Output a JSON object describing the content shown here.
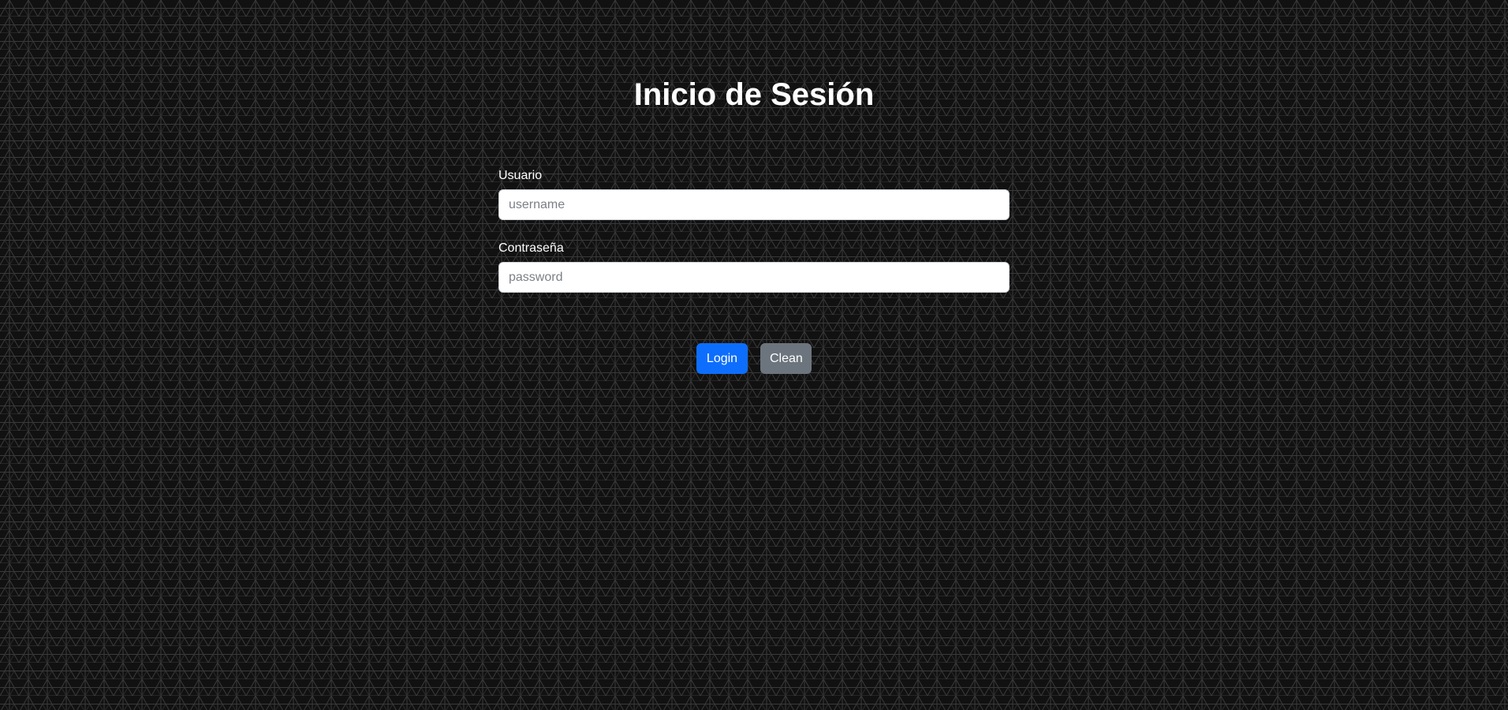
{
  "page": {
    "title": "Inicio de Sesión"
  },
  "form": {
    "username": {
      "label": "Usuario",
      "placeholder": "username",
      "value": ""
    },
    "password": {
      "label": "Contraseña",
      "placeholder": "password",
      "value": ""
    }
  },
  "actions": {
    "login_label": "Login",
    "clean_label": "Clean"
  },
  "colors": {
    "background": "#111111",
    "primary": "#0d6efd",
    "secondary": "#6c757d",
    "text": "#ffffff"
  }
}
